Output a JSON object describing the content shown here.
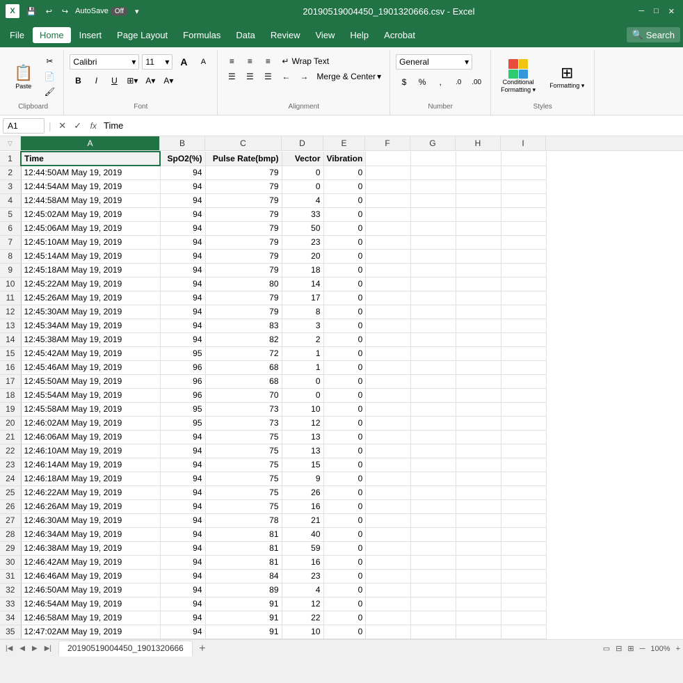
{
  "titleBar": {
    "icon": "X",
    "fileName": "20190519004450_1901320666.csv  -  Excel",
    "undoBtn": "↩",
    "redoBtn": "↪",
    "autoSave": "AutoSave",
    "toggleState": "Off",
    "customizeBtn": "▾"
  },
  "menuBar": {
    "items": [
      "File",
      "Home",
      "Insert",
      "Page Layout",
      "Formulas",
      "Data",
      "Review",
      "View",
      "Help",
      "Acrobat"
    ],
    "activeItem": "Home",
    "searchPlaceholder": "Search",
    "searchIcon": "🔍"
  },
  "ribbon": {
    "clipboard": {
      "label": "Clipboard",
      "pasteLabel": "Paste",
      "cutLabel": "Cut",
      "copyLabel": "Copy",
      "formatPainterLabel": "Format Painter"
    },
    "font": {
      "label": "Font",
      "fontName": "Calibri",
      "fontSize": "11",
      "boldLabel": "B",
      "italicLabel": "I",
      "underlineLabel": "U",
      "highlightColor": "#FFFF00",
      "fontColor": "#FF0000",
      "increaseFontLabel": "A",
      "decreaseFontLabel": "A"
    },
    "alignment": {
      "label": "Alignment",
      "wrapTextLabel": "Wrap Text",
      "mergeCenterLabel": "Merge & Center",
      "indentDecLabel": "←",
      "indentIncLabel": "→"
    },
    "number": {
      "label": "Number",
      "format": "General",
      "currencyLabel": "$",
      "percentLabel": "%",
      "commaLabel": ",",
      "decIncLabel": ".0",
      "decDecLabel": ".00"
    },
    "styles": {
      "label": "Styles",
      "conditionalFormattingLabel": "Conditional\nFormatting",
      "formattingLabel": "Formatting"
    }
  },
  "formulaBar": {
    "cellRef": "A1",
    "cancelLabel": "✕",
    "confirmLabel": "✓",
    "fxLabel": "fx",
    "formula": "Time"
  },
  "columns": {
    "headers": [
      "",
      "A",
      "B",
      "C",
      "D",
      "E",
      "F",
      "G",
      "H",
      "I"
    ],
    "widths": [
      30,
      200,
      65,
      110,
      60,
      60,
      65,
      65,
      65,
      65
    ]
  },
  "tableHeaders": {
    "A": "Time",
    "B": "SpO2(%)",
    "C": "Pulse Rate(bmp)",
    "D": "Vector",
    "E": "Vibration"
  },
  "rows": [
    {
      "num": 2,
      "A": "12:44:50AM May 19, 2019",
      "B": 94,
      "C": 79,
      "D": 0,
      "E": 0
    },
    {
      "num": 3,
      "A": "12:44:54AM May 19, 2019",
      "B": 94,
      "C": 79,
      "D": 0,
      "E": 0
    },
    {
      "num": 4,
      "A": "12:44:58AM May 19, 2019",
      "B": 94,
      "C": 79,
      "D": 4,
      "E": 0
    },
    {
      "num": 5,
      "A": "12:45:02AM May 19, 2019",
      "B": 94,
      "C": 79,
      "D": 33,
      "E": 0
    },
    {
      "num": 6,
      "A": "12:45:06AM May 19, 2019",
      "B": 94,
      "C": 79,
      "D": 50,
      "E": 0
    },
    {
      "num": 7,
      "A": "12:45:10AM May 19, 2019",
      "B": 94,
      "C": 79,
      "D": 23,
      "E": 0
    },
    {
      "num": 8,
      "A": "12:45:14AM May 19, 2019",
      "B": 94,
      "C": 79,
      "D": 20,
      "E": 0
    },
    {
      "num": 9,
      "A": "12:45:18AM May 19, 2019",
      "B": 94,
      "C": 79,
      "D": 18,
      "E": 0
    },
    {
      "num": 10,
      "A": "12:45:22AM May 19, 2019",
      "B": 94,
      "C": 80,
      "D": 14,
      "E": 0
    },
    {
      "num": 11,
      "A": "12:45:26AM May 19, 2019",
      "B": 94,
      "C": 79,
      "D": 17,
      "E": 0
    },
    {
      "num": 12,
      "A": "12:45:30AM May 19, 2019",
      "B": 94,
      "C": 79,
      "D": 8,
      "E": 0
    },
    {
      "num": 13,
      "A": "12:45:34AM May 19, 2019",
      "B": 94,
      "C": 83,
      "D": 3,
      "E": 0
    },
    {
      "num": 14,
      "A": "12:45:38AM May 19, 2019",
      "B": 94,
      "C": 82,
      "D": 2,
      "E": 0
    },
    {
      "num": 15,
      "A": "12:45:42AM May 19, 2019",
      "B": 95,
      "C": 72,
      "D": 1,
      "E": 0
    },
    {
      "num": 16,
      "A": "12:45:46AM May 19, 2019",
      "B": 96,
      "C": 68,
      "D": 1,
      "E": 0
    },
    {
      "num": 17,
      "A": "12:45:50AM May 19, 2019",
      "B": 96,
      "C": 68,
      "D": 0,
      "E": 0
    },
    {
      "num": 18,
      "A": "12:45:54AM May 19, 2019",
      "B": 96,
      "C": 70,
      "D": 0,
      "E": 0
    },
    {
      "num": 19,
      "A": "12:45:58AM May 19, 2019",
      "B": 95,
      "C": 73,
      "D": 10,
      "E": 0
    },
    {
      "num": 20,
      "A": "12:46:02AM May 19, 2019",
      "B": 95,
      "C": 73,
      "D": 12,
      "E": 0
    },
    {
      "num": 21,
      "A": "12:46:06AM May 19, 2019",
      "B": 94,
      "C": 75,
      "D": 13,
      "E": 0
    },
    {
      "num": 22,
      "A": "12:46:10AM May 19, 2019",
      "B": 94,
      "C": 75,
      "D": 13,
      "E": 0
    },
    {
      "num": 23,
      "A": "12:46:14AM May 19, 2019",
      "B": 94,
      "C": 75,
      "D": 15,
      "E": 0
    },
    {
      "num": 24,
      "A": "12:46:18AM May 19, 2019",
      "B": 94,
      "C": 75,
      "D": 9,
      "E": 0
    },
    {
      "num": 25,
      "A": "12:46:22AM May 19, 2019",
      "B": 94,
      "C": 75,
      "D": 26,
      "E": 0
    },
    {
      "num": 26,
      "A": "12:46:26AM May 19, 2019",
      "B": 94,
      "C": 75,
      "D": 16,
      "E": 0
    },
    {
      "num": 27,
      "A": "12:46:30AM May 19, 2019",
      "B": 94,
      "C": 78,
      "D": 21,
      "E": 0
    },
    {
      "num": 28,
      "A": "12:46:34AM May 19, 2019",
      "B": 94,
      "C": 81,
      "D": 40,
      "E": 0
    },
    {
      "num": 29,
      "A": "12:46:38AM May 19, 2019",
      "B": 94,
      "C": 81,
      "D": 59,
      "E": 0
    },
    {
      "num": 30,
      "A": "12:46:42AM May 19, 2019",
      "B": 94,
      "C": 81,
      "D": 16,
      "E": 0
    },
    {
      "num": 31,
      "A": "12:46:46AM May 19, 2019",
      "B": 94,
      "C": 84,
      "D": 23,
      "E": 0
    },
    {
      "num": 32,
      "A": "12:46:50AM May 19, 2019",
      "B": 94,
      "C": 89,
      "D": 4,
      "E": 0
    },
    {
      "num": 33,
      "A": "12:46:54AM May 19, 2019",
      "B": 94,
      "C": 91,
      "D": 12,
      "E": 0
    },
    {
      "num": 34,
      "A": "12:46:58AM May 19, 2019",
      "B": 94,
      "C": 91,
      "D": 22,
      "E": 0
    },
    {
      "num": 35,
      "A": "12:47:02AM May 19, 2019",
      "B": 94,
      "C": 91,
      "D": 10,
      "E": 0
    }
  ],
  "sheetTabs": {
    "activeTab": "20190519004450_1901320666",
    "tabs": [
      "20190519004450_1901320666"
    ]
  },
  "statusBar": {
    "leftItems": [],
    "rightItems": [
      "",
      "",
      ""
    ]
  }
}
